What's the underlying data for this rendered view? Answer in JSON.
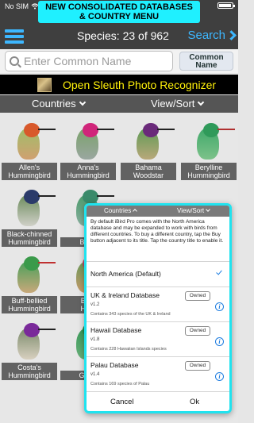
{
  "status_bar": {
    "carrier": "No SIM",
    "wifi_icon": "wifi-icon",
    "battery_icon": "battery-icon"
  },
  "banner": {
    "line1": "NEW CONSOLIDATED DATABASES",
    "line2": "& COUNTRY MENU",
    "color": "#1ff0ff"
  },
  "header": {
    "species_count": "Species: 23 of 962",
    "search_label": "Search",
    "accent": "#3db7ff"
  },
  "search": {
    "placeholder": "Enter Common Name",
    "value": "",
    "name_mode_line1": "Common",
    "name_mode_line2": "Name"
  },
  "sleuth": {
    "label": "Open Sleuth Photo Recognizer",
    "color": "#fff10a"
  },
  "sort_bar": {
    "countries_label": "Countries",
    "view_sort_label": "View/Sort"
  },
  "birds": [
    {
      "name1": "Allen's",
      "name2": "Hummingbird"
    },
    {
      "name1": "Anna's",
      "name2": "Hummingbird"
    },
    {
      "name1": "Bahama",
      "name2": "Woodstar"
    },
    {
      "name1": "Berylline",
      "name2": "Hummingbird"
    },
    {
      "name1": "Black-chinned",
      "name2": "Hummingbird"
    },
    {
      "name1": "Blue-",
      "name2": ""
    },
    {
      "name1": "Buff-bellied",
      "name2": "Hummingbird"
    },
    {
      "name1": "Bum",
      "name2": "Hum"
    },
    {
      "name1": "Costa's",
      "name2": "Hummingbird"
    },
    {
      "name1": "Greer",
      "name2": ""
    }
  ],
  "modal": {
    "header_left": "Countries",
    "header_right": "View/Sort",
    "description": "By default iBird Pro comes with the North America database and may be expanded to work with birds from different countries. To buy a different country, tap the Buy button adjacent to its title. Tap the country title to enable it.",
    "default_db": "North America (Default)",
    "databases": [
      {
        "name": "UK & Ireland Database",
        "version": "v1.2",
        "contains": "Contains 343 species of the UK & Ireland",
        "button": "Owned"
      },
      {
        "name": "Hawaii Database",
        "version": "v1.8",
        "contains": "Contains 228 Hawaiian Islands species",
        "button": "Owned"
      },
      {
        "name": "Palau Database",
        "version": "v1.4",
        "contains": "Contains 169 species of Palau",
        "button": "Owned"
      }
    ],
    "cancel": "Cancel",
    "ok": "Ok",
    "border_color": "#20e3ef"
  }
}
